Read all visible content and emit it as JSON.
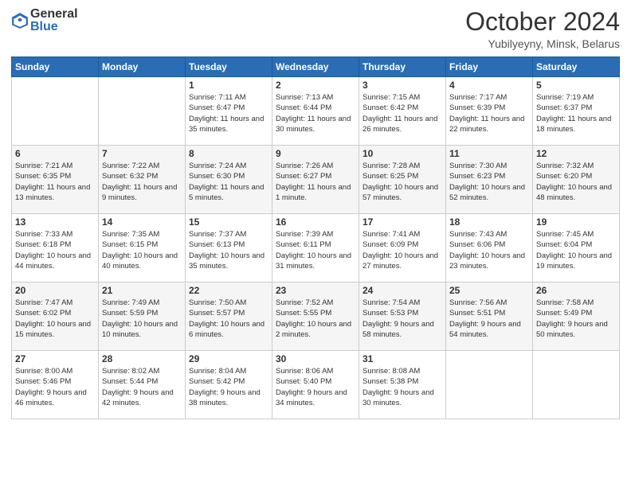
{
  "header": {
    "logo_general": "General",
    "logo_blue": "Blue",
    "title": "October 2024",
    "location": "Yubilyeyny, Minsk, Belarus"
  },
  "weekdays": [
    "Sunday",
    "Monday",
    "Tuesday",
    "Wednesday",
    "Thursday",
    "Friday",
    "Saturday"
  ],
  "weeks": [
    [
      {
        "day": "",
        "info": ""
      },
      {
        "day": "",
        "info": ""
      },
      {
        "day": "1",
        "info": "Sunrise: 7:11 AM\nSunset: 6:47 PM\nDaylight: 11 hours and 35 minutes."
      },
      {
        "day": "2",
        "info": "Sunrise: 7:13 AM\nSunset: 6:44 PM\nDaylight: 11 hours and 30 minutes."
      },
      {
        "day": "3",
        "info": "Sunrise: 7:15 AM\nSunset: 6:42 PM\nDaylight: 11 hours and 26 minutes."
      },
      {
        "day": "4",
        "info": "Sunrise: 7:17 AM\nSunset: 6:39 PM\nDaylight: 11 hours and 22 minutes."
      },
      {
        "day": "5",
        "info": "Sunrise: 7:19 AM\nSunset: 6:37 PM\nDaylight: 11 hours and 18 minutes."
      }
    ],
    [
      {
        "day": "6",
        "info": "Sunrise: 7:21 AM\nSunset: 6:35 PM\nDaylight: 11 hours and 13 minutes."
      },
      {
        "day": "7",
        "info": "Sunrise: 7:22 AM\nSunset: 6:32 PM\nDaylight: 11 hours and 9 minutes."
      },
      {
        "day": "8",
        "info": "Sunrise: 7:24 AM\nSunset: 6:30 PM\nDaylight: 11 hours and 5 minutes."
      },
      {
        "day": "9",
        "info": "Sunrise: 7:26 AM\nSunset: 6:27 PM\nDaylight: 11 hours and 1 minute."
      },
      {
        "day": "10",
        "info": "Sunrise: 7:28 AM\nSunset: 6:25 PM\nDaylight: 10 hours and 57 minutes."
      },
      {
        "day": "11",
        "info": "Sunrise: 7:30 AM\nSunset: 6:23 PM\nDaylight: 10 hours and 52 minutes."
      },
      {
        "day": "12",
        "info": "Sunrise: 7:32 AM\nSunset: 6:20 PM\nDaylight: 10 hours and 48 minutes."
      }
    ],
    [
      {
        "day": "13",
        "info": "Sunrise: 7:33 AM\nSunset: 6:18 PM\nDaylight: 10 hours and 44 minutes."
      },
      {
        "day": "14",
        "info": "Sunrise: 7:35 AM\nSunset: 6:15 PM\nDaylight: 10 hours and 40 minutes."
      },
      {
        "day": "15",
        "info": "Sunrise: 7:37 AM\nSunset: 6:13 PM\nDaylight: 10 hours and 35 minutes."
      },
      {
        "day": "16",
        "info": "Sunrise: 7:39 AM\nSunset: 6:11 PM\nDaylight: 10 hours and 31 minutes."
      },
      {
        "day": "17",
        "info": "Sunrise: 7:41 AM\nSunset: 6:09 PM\nDaylight: 10 hours and 27 minutes."
      },
      {
        "day": "18",
        "info": "Sunrise: 7:43 AM\nSunset: 6:06 PM\nDaylight: 10 hours and 23 minutes."
      },
      {
        "day": "19",
        "info": "Sunrise: 7:45 AM\nSunset: 6:04 PM\nDaylight: 10 hours and 19 minutes."
      }
    ],
    [
      {
        "day": "20",
        "info": "Sunrise: 7:47 AM\nSunset: 6:02 PM\nDaylight: 10 hours and 15 minutes."
      },
      {
        "day": "21",
        "info": "Sunrise: 7:49 AM\nSunset: 5:59 PM\nDaylight: 10 hours and 10 minutes."
      },
      {
        "day": "22",
        "info": "Sunrise: 7:50 AM\nSunset: 5:57 PM\nDaylight: 10 hours and 6 minutes."
      },
      {
        "day": "23",
        "info": "Sunrise: 7:52 AM\nSunset: 5:55 PM\nDaylight: 10 hours and 2 minutes."
      },
      {
        "day": "24",
        "info": "Sunrise: 7:54 AM\nSunset: 5:53 PM\nDaylight: 9 hours and 58 minutes."
      },
      {
        "day": "25",
        "info": "Sunrise: 7:56 AM\nSunset: 5:51 PM\nDaylight: 9 hours and 54 minutes."
      },
      {
        "day": "26",
        "info": "Sunrise: 7:58 AM\nSunset: 5:49 PM\nDaylight: 9 hours and 50 minutes."
      }
    ],
    [
      {
        "day": "27",
        "info": "Sunrise: 8:00 AM\nSunset: 5:46 PM\nDaylight: 9 hours and 46 minutes."
      },
      {
        "day": "28",
        "info": "Sunrise: 8:02 AM\nSunset: 5:44 PM\nDaylight: 9 hours and 42 minutes."
      },
      {
        "day": "29",
        "info": "Sunrise: 8:04 AM\nSunset: 5:42 PM\nDaylight: 9 hours and 38 minutes."
      },
      {
        "day": "30",
        "info": "Sunrise: 8:06 AM\nSunset: 5:40 PM\nDaylight: 9 hours and 34 minutes."
      },
      {
        "day": "31",
        "info": "Sunrise: 8:08 AM\nSunset: 5:38 PM\nDaylight: 9 hours and 30 minutes."
      },
      {
        "day": "",
        "info": ""
      },
      {
        "day": "",
        "info": ""
      }
    ]
  ]
}
